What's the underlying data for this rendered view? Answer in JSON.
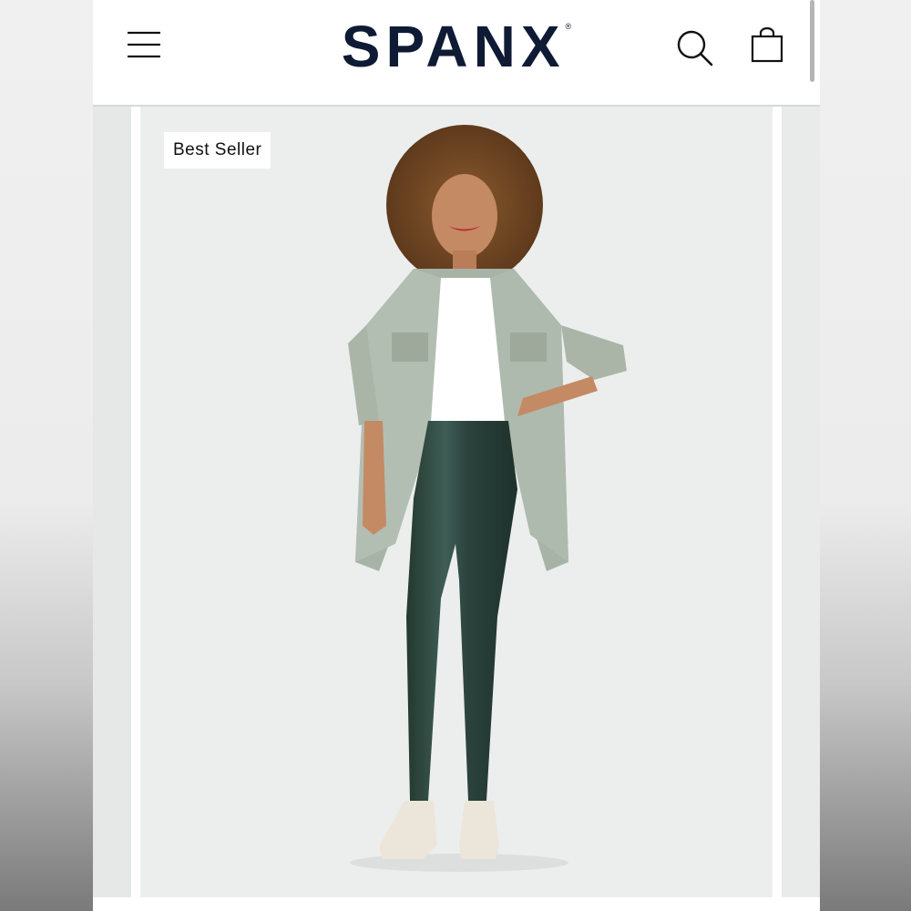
{
  "header": {
    "brand": "SPANX",
    "brand_mark": "®",
    "menu_icon": "hamburger-menu-icon",
    "search_icon": "search-icon",
    "cart_icon": "shopping-bag-icon"
  },
  "product_image": {
    "badge": "Best Seller"
  },
  "colors": {
    "brand_text": "#0f1a34",
    "slide_background": "#eceeed",
    "leggings": "#2f4a44"
  }
}
